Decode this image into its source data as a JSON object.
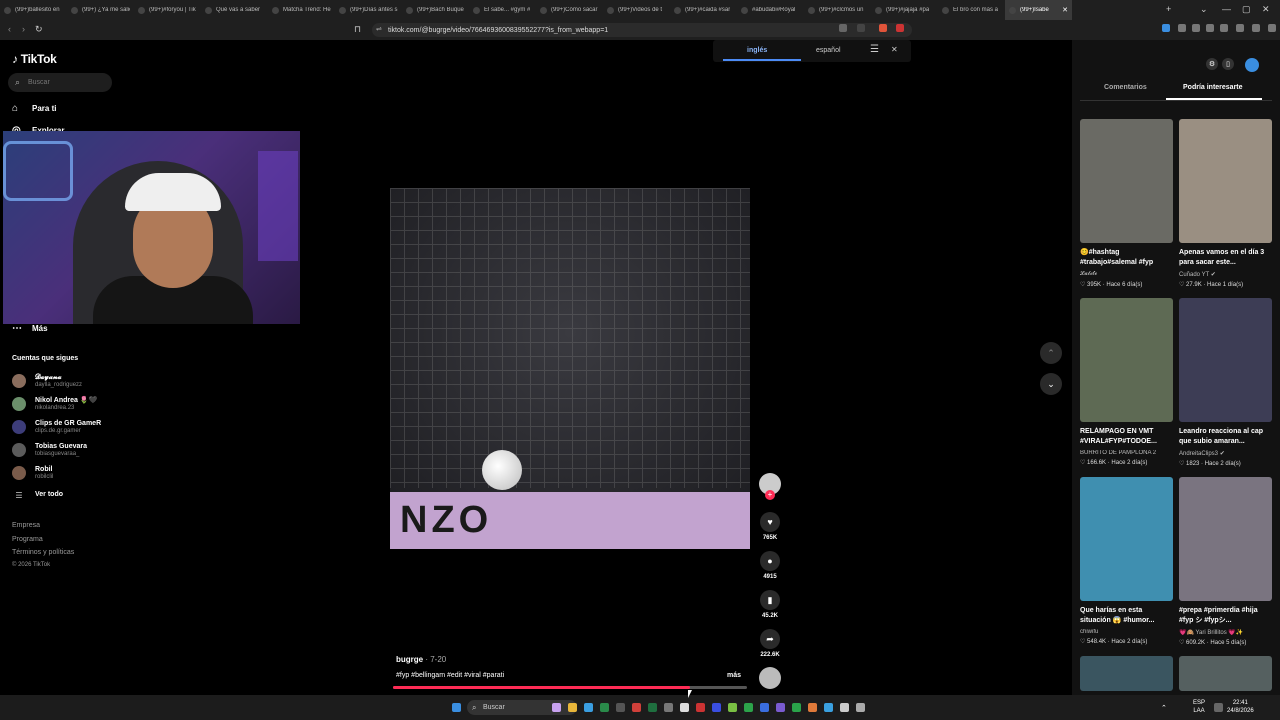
{
  "browser": {
    "tabs": [
      {
        "title": "(99+)ballesito en"
      },
      {
        "title": "(99+) ¿Ya me salió"
      },
      {
        "title": "(99+)#foryou | Tik"
      },
      {
        "title": "Qué vas a saber"
      },
      {
        "title": "Matcha Trend: He"
      },
      {
        "title": "(99+)Días antes s"
      },
      {
        "title": "(99+)Bach Buque"
      },
      {
        "title": "El sabe... #gym #"
      },
      {
        "title": "(99+)Cómo sacar"
      },
      {
        "title": "(99+)Videos de t"
      },
      {
        "title": "(99+)#caida #sar"
      },
      {
        "title": "#abudabi#Royal"
      },
      {
        "title": "(99+)#clcmos un"
      },
      {
        "title": "(99+)#jajaja #pa"
      },
      {
        "title": "El bro con más a"
      },
      {
        "title": "(99+)Isabe",
        "active": true
      }
    ],
    "tab_close": "✕",
    "new_tab": "+",
    "url": "tiktok.com/@bugrge/video/7664693600839552277?is_from_webapp=1",
    "translate": {
      "lang_active": "inglés",
      "lang_other": "español"
    }
  },
  "sidebar": {
    "logo": "TikTok",
    "search_placeholder": "Buscar",
    "nav": [
      {
        "label": "Para ti",
        "icon": "home-icon"
      },
      {
        "label": "Explorar",
        "icon": "compass-icon"
      },
      {
        "label": "Más",
        "icon": "more-icon"
      }
    ],
    "following_title": "Cuentas que sigues",
    "following": [
      {
        "name": "𝓓𝓪𝔂𝓪𝓷𝓪",
        "handle": "daylla_rodriguezz"
      },
      {
        "name": "Nikol Andrea 🌷🖤",
        "handle": "nikolandrea.23"
      },
      {
        "name": "Clips de GR GameR",
        "handle": "clips.de.gr.gamer"
      },
      {
        "name": "Tobias Guevara",
        "handle": "tobiasguevaraa_"
      },
      {
        "name": "Robil",
        "handle": "robilclil"
      }
    ],
    "see_all": "Ver todo",
    "footer": [
      "Empresa",
      "Programa",
      "Términos y políticas",
      "© 2026 TikTok"
    ]
  },
  "video": {
    "banner_text": "NZO",
    "author": "bugrge",
    "date": "· 7-20",
    "tags": "#fyp #bellingam #edit #viral #parati",
    "more": "más",
    "progress": 0.84
  },
  "actions": {
    "likes": "765K",
    "comments": "4915",
    "saves": "45.2K",
    "shares": "222.6K"
  },
  "right_panel": {
    "tabs": [
      "Comentarios",
      "Podría interesarte"
    ],
    "active_tab": 1,
    "cards": [
      {
        "title": "😊#hashtag #trabajo#salemal #fyp",
        "author": "𝓛𝓪𝓵𝓲𝓽𝓸",
        "stats": "♡ 395K · Hace 6 día(s)",
        "color": "#6a6a64"
      },
      {
        "title": "Apenas vamos en el día 3 para sacar este...",
        "author": "Cuñado YT ✔",
        "stats": "♡ 27.9K · Hace 1 día(s)",
        "color": "#9a8f82"
      },
      {
        "title": "RELÁMPAGO EN VMT #VIRAL#FYP#TODOE...",
        "author": "BURRITO DE PAMPLONA 2",
        "stats": "♡ 166.6K · Hace 2 día(s)",
        "color": "#5e6a54"
      },
      {
        "title": "Leandro reacciona al cap que subio amaran...",
        "author": "AndreitaClips3 ✔",
        "stats": "♡ 1823 · Hace 2 día(s)",
        "color": "#3d3d55"
      },
      {
        "title": "Que harías en esta situación 😱 #humor...",
        "author": "chiwifu",
        "stats": "♡ 548.4K · Hace 2 día(s)",
        "color": "#3f8fb0"
      },
      {
        "title": "#prepa #primerdia #hija #fyp シ #fypシ...",
        "author": "💗🙈 Yari Brillitos 💗✨",
        "stats": "♡ 609.2K · Hace 5 día(s)",
        "color": "#7a7480"
      }
    ]
  },
  "taskbar": {
    "search": "Buscar",
    "lang": "ESP",
    "lang2": "LAA",
    "time": "22:41",
    "date": "24/8/2026"
  }
}
